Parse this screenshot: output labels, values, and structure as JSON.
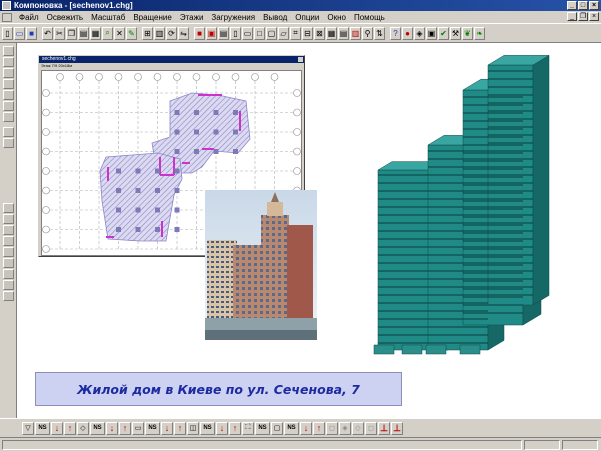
{
  "window": {
    "title": "Компоновка - [sechenov1.chg]"
  },
  "menu": [
    "Файл",
    "Освежить",
    "Масштаб",
    "Вращение",
    "Этажи",
    "Загружения",
    "Вывод",
    "Опции",
    "Окно",
    "Помощь"
  ],
  "child_window": {
    "title": "sechenov1.chg",
    "toolbar_text": "Этаж 7/9  20x18м"
  },
  "caption": "Жилой дом в Киеве по ул. Сеченова, 7",
  "bottom_toolbar": {
    "ns_label": "NS"
  },
  "colors": {
    "titlebar": "#0a246a",
    "building": "#1f8a86",
    "caption_bg": "#cdd2f2",
    "caption_text": "#1d2aa0",
    "plan_hatch": "#8a86c8",
    "plan_walls": "#cc33cc"
  }
}
